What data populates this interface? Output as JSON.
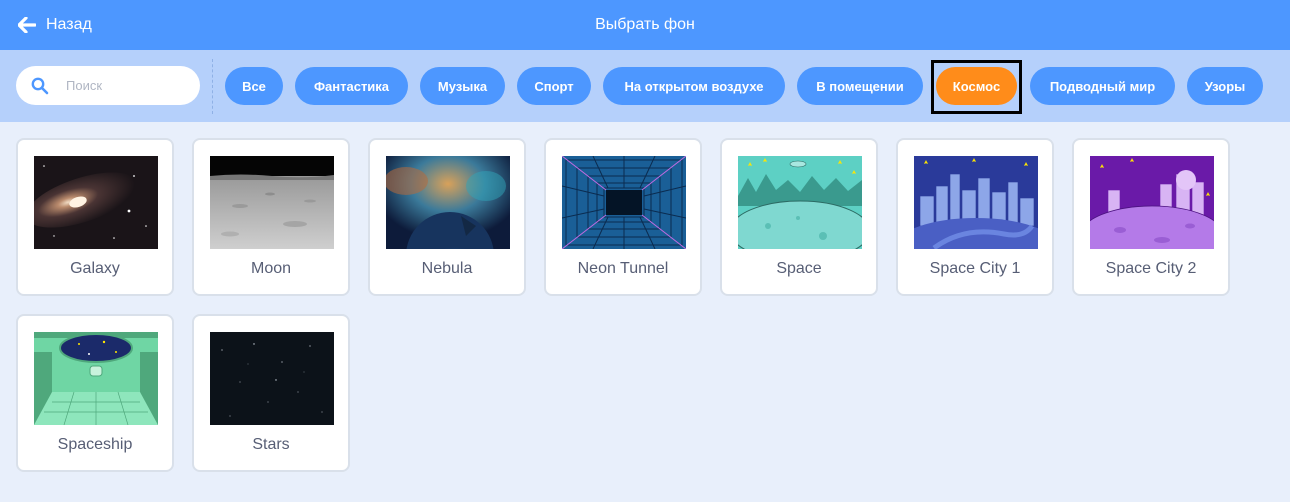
{
  "header": {
    "back_label": "Назад",
    "title": "Выбрать фон",
    "background": "#4d97ff"
  },
  "search": {
    "value": "",
    "placeholder": "Поиск"
  },
  "tags": [
    {
      "label": "Все",
      "active": false
    },
    {
      "label": "Фантастика",
      "active": false
    },
    {
      "label": "Музыка",
      "active": false
    },
    {
      "label": "Спорт",
      "active": false
    },
    {
      "label": "На открытом воздухе",
      "active": false
    },
    {
      "label": "В помещении",
      "active": false
    },
    {
      "label": "Космос",
      "active": true
    },
    {
      "label": "Подводный мир",
      "active": false
    },
    {
      "label": "Узоры",
      "active": false
    }
  ],
  "colors": {
    "tag": "#4d97ff",
    "tag_active": "#ff8c1a",
    "filter_bar": "#b5d0fb",
    "page": "#e8effb"
  },
  "backdrops": [
    {
      "name": "Galaxy"
    },
    {
      "name": "Moon"
    },
    {
      "name": "Nebula"
    },
    {
      "name": "Neon Tunnel"
    },
    {
      "name": "Space"
    },
    {
      "name": "Space City 1"
    },
    {
      "name": "Space City 2"
    },
    {
      "name": "Spaceship"
    },
    {
      "name": "Stars"
    }
  ]
}
